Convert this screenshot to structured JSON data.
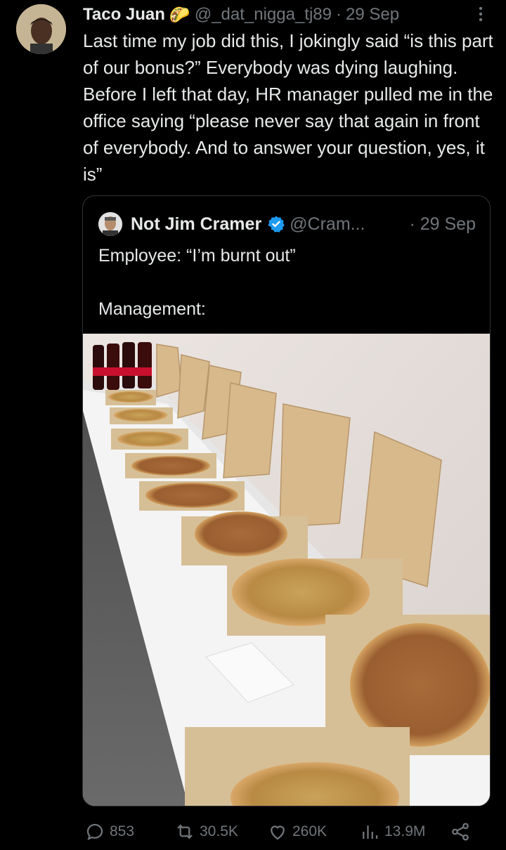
{
  "tweet": {
    "author_name": "Taco Juan",
    "author_emoji": "🌮",
    "handle": "@_dat_nigga_tj89",
    "separator": "·",
    "date": "29 Sep",
    "text": "Last time my job did this, I jokingly said “is this part of our bonus?” Everybody was dying laughing. Before I left that day, HR manager pulled me in the office saying “please never say that again in front of everybody. And to answer your question, yes, it is”"
  },
  "quoted": {
    "author_name": "Not Jim Cramer",
    "handle": "@Cram...",
    "date": "· 29 Sep",
    "text": "Employee: “I’m burnt out”\n\nManagement:"
  },
  "actions": {
    "replies": "853",
    "reposts": "30.5K",
    "likes": "260K",
    "views": "13.9M"
  },
  "colors": {
    "background": "#000000",
    "text": "#e7e9ea",
    "muted": "#71767b",
    "verified": "#1d9bf0",
    "border": "#2f3336"
  },
  "icons": [
    "more-icon",
    "verified-icon",
    "reply-icon",
    "repost-icon",
    "like-icon",
    "views-icon",
    "share-icon"
  ]
}
